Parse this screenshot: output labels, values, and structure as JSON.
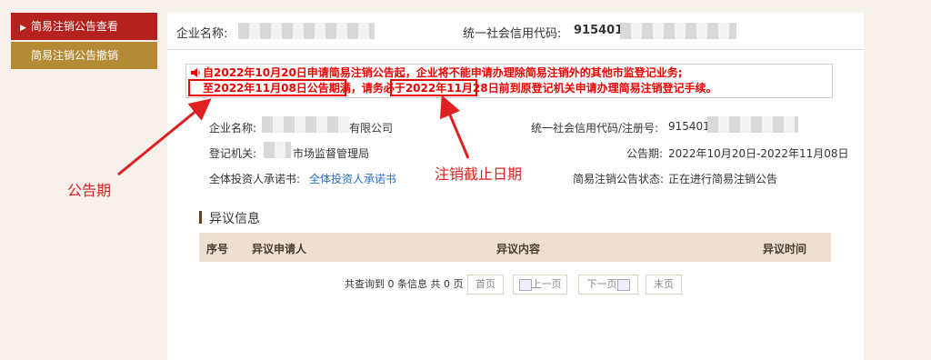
{
  "sidebar": {
    "items": [
      {
        "label": "简易注销公告查看",
        "arrow": "▶"
      },
      {
        "label": "简易注销公告撤销"
      }
    ]
  },
  "topbar": {
    "company_label": "企业名称:",
    "credit_label": "统一社会信用代码:",
    "credit_prefix": "915401"
  },
  "notice": {
    "line1": "自2022年10月20日申请简易注销公告起，企业将不能申请办理除简易注销外的其他市监登记业务;",
    "line2_a": "至2022年11月08日公告期满",
    "line2_b": "，请务必于",
    "line2_c": "2022年11月28日",
    "line2_d": "前到原登记机关申请办理简易注销登记手续。"
  },
  "info": {
    "company_label": "企业名称:",
    "company_suffix": "有限公司",
    "credit_label": "统一社会信用代码/注册号:",
    "credit_prefix": "915401",
    "authority_label": "登记机关:",
    "authority_suffix": "市场监督管理局",
    "period_label": "公告期:",
    "period_value": "2022年10月20日-2022年11月08日",
    "promise_label": "全体投资人承诺书:",
    "promise_link": "全体投资人承诺书",
    "status_label": "简易注销公告状态:",
    "status_value": "正在进行简易注销公告"
  },
  "objection": {
    "title": "异议信息",
    "columns": [
      "序号",
      "异议申请人",
      "异议内容",
      "异议时间"
    ]
  },
  "pager": {
    "summary": "共查询到 0 条信息  共 0 页",
    "first": "首页",
    "prev": "上一页",
    "next": "下一页",
    "last": "末页"
  },
  "annotations": {
    "period": "公告期",
    "deadline": "注销截止日期"
  },
  "colors": {
    "accent_red": "#b5211e",
    "accent_gold": "#b48a35",
    "annotation_red": "#e02020"
  }
}
